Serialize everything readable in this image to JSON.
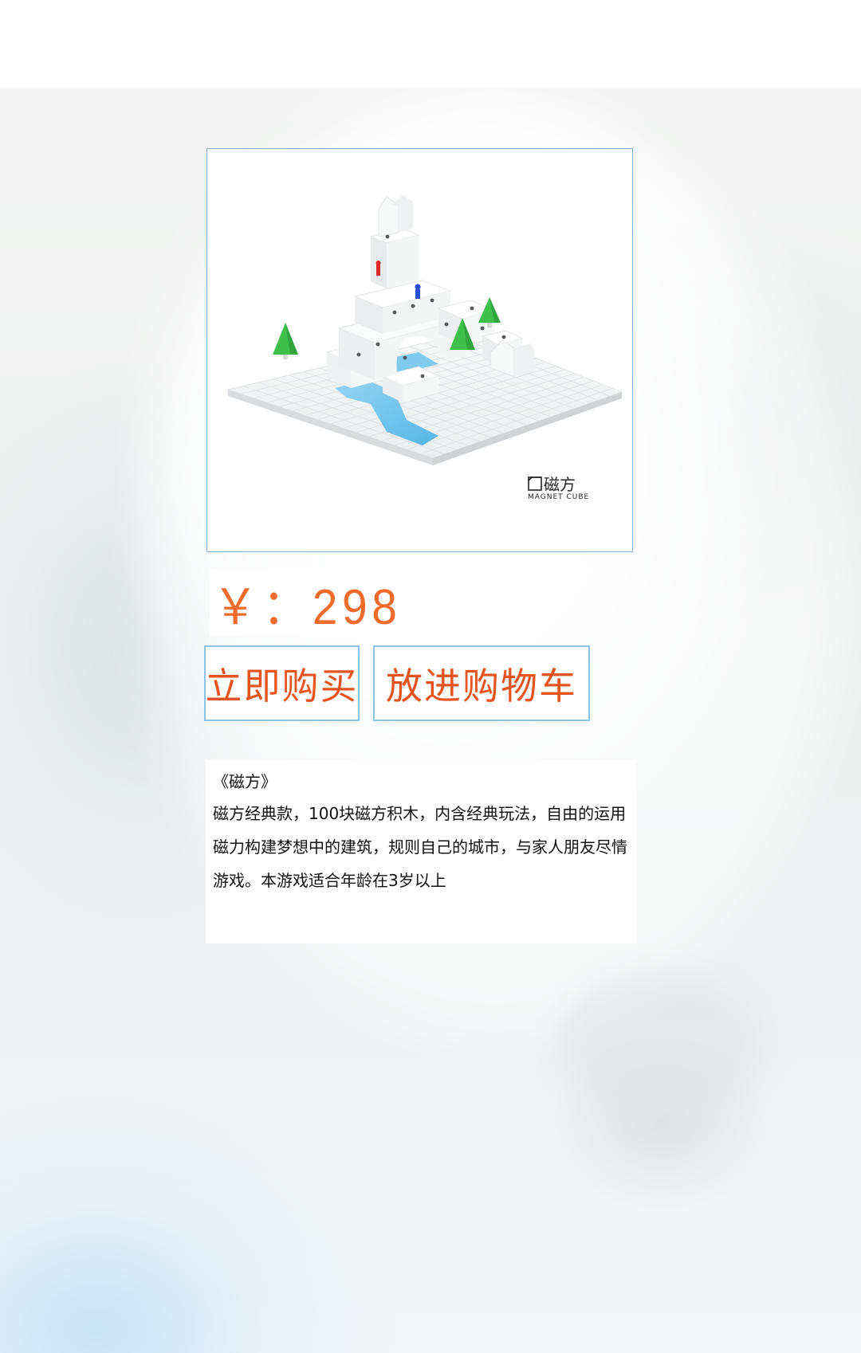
{
  "product": {
    "image_alt": "磁方 积木场景",
    "logo_text": "磁方",
    "logo_subtext": "MAGNET CUBE"
  },
  "price": {
    "text": "￥：298"
  },
  "actions": {
    "buy_now_label": "立即购买",
    "add_to_cart_label": "放进购物车"
  },
  "description": {
    "title": "《磁方》",
    "body": "磁方经典款，100块磁方积木，内含经典玩法，自由的运用磁力构建梦想中的建筑，规则自己的城市，与家人朋友尽情游戏。本游戏适合年龄在3岁以上"
  },
  "colors": {
    "price_orange": "#f26b2b",
    "button_text": "#e8541e",
    "button_border": "#8cc3ea",
    "frame_border": "#7fb0d8",
    "water_blue": "#6cc3ee",
    "tree_green": "#3fc04a"
  }
}
